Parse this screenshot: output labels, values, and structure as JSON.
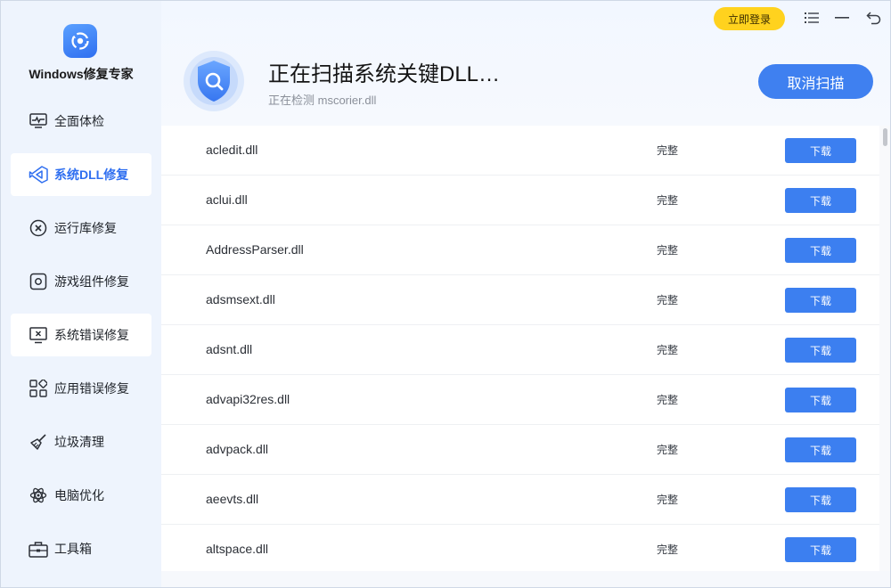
{
  "app": {
    "title": "Windows修复专家"
  },
  "sidebar": {
    "items": [
      {
        "label": "全面体检",
        "icon": "pulse-monitor-icon"
      },
      {
        "label": "系统DLL修复",
        "icon": "visual-studio-icon"
      },
      {
        "label": "运行库修复",
        "icon": "circle-x-icon"
      },
      {
        "label": "游戏组件修复",
        "icon": "gear-square-icon"
      },
      {
        "label": "系统错误修复",
        "icon": "monitor-x-icon"
      },
      {
        "label": "应用错误修复",
        "icon": "apps-grid-icon"
      },
      {
        "label": "垃圾清理",
        "icon": "broom-icon"
      },
      {
        "label": "电脑优化",
        "icon": "atom-icon"
      },
      {
        "label": "工具箱",
        "icon": "toolbox-icon"
      }
    ],
    "selected_index": 1
  },
  "header": {
    "login_label": "立即登录",
    "scan_title": "正在扫描系统关键DLL…",
    "scan_subtitle": "正在检测 mscorier.dll",
    "cancel_label": "取消扫描"
  },
  "window_controls": [
    "menu-icon",
    "minimize-icon",
    "back-icon"
  ],
  "list": {
    "rows": [
      {
        "name": "acledit.dll",
        "status": "完整",
        "action": "下载"
      },
      {
        "name": "aclui.dll",
        "status": "完整",
        "action": "下载"
      },
      {
        "name": "AddressParser.dll",
        "status": "完整",
        "action": "下载"
      },
      {
        "name": "adsmsext.dll",
        "status": "完整",
        "action": "下载"
      },
      {
        "name": "adsnt.dll",
        "status": "完整",
        "action": "下载"
      },
      {
        "name": "advapi32res.dll",
        "status": "完整",
        "action": "下载"
      },
      {
        "name": "advpack.dll",
        "status": "完整",
        "action": "下载"
      },
      {
        "name": "aeevts.dll",
        "status": "完整",
        "action": "下载"
      },
      {
        "name": "altspace.dll",
        "status": "完整",
        "action": "下载"
      }
    ]
  },
  "colors": {
    "accent": "#3c7ff0",
    "login_yellow": "#ffd21e",
    "sidebar_bg": "#eef4fd"
  }
}
